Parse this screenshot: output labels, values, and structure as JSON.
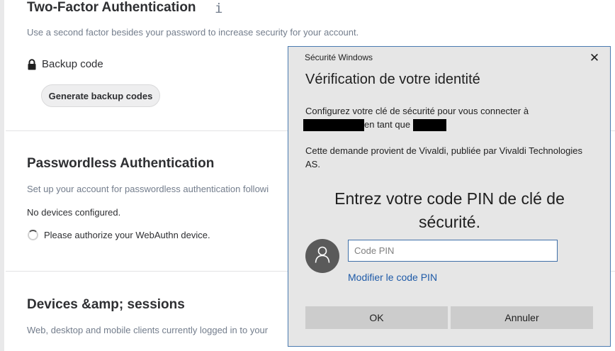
{
  "two_factor": {
    "title": "Two-Factor Authentication",
    "info_icon": "i",
    "description": "Use a second factor besides your password to increase security for your account.",
    "backup_label": "Backup code",
    "generate_button": "Generate backup codes"
  },
  "passwordless": {
    "title": "Passwordless Authentication",
    "description": "Set up your account for passwordless authentication followi",
    "no_devices": "No devices configured.",
    "authorize_status": "Please authorize your WebAuthn device."
  },
  "devices": {
    "title": "Devices &amp; sessions",
    "description": "Web, desktop and mobile clients currently logged in to your"
  },
  "dialog": {
    "caption": "Sécurité Windows",
    "close_glyph": "✕",
    "heading": "Vérification de votre identité",
    "para1_line1": "Configurez votre clé de sécurité pour vous connecter à",
    "para1_mid": "en tant que",
    "para2": "Cette demande provient de Vivaldi, publiée par Vivaldi Technologies AS.",
    "pin_title": "Entrez votre code PIN de clé de sécurité.",
    "pin_placeholder": "Code PIN",
    "change_pin_link": "Modifier le code PIN",
    "ok_button": "OK",
    "cancel_button": "Annuler",
    "avatar_icon": "user-icon"
  },
  "colors": {
    "dialog_bg": "#e6e6e6",
    "link": "#1e5aa8",
    "button_bg": "#cccccc",
    "muted_text": "#737d8c"
  }
}
